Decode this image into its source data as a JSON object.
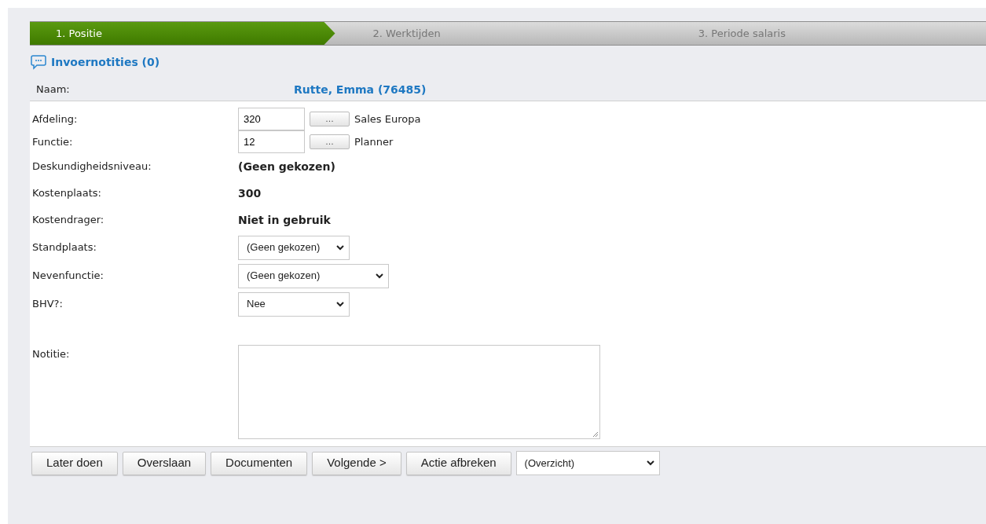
{
  "steps": [
    {
      "label": "1. Positie",
      "selected": true
    },
    {
      "label": "2. Werktijden",
      "selected": false
    },
    {
      "label": "3. Periode salaris",
      "selected": false
    }
  ],
  "notes_link": "Invoernotities (0)",
  "name_row": {
    "label": "Naam:",
    "value": "Rutte, Emma (76485)"
  },
  "fields": [
    {
      "kind": "lookup",
      "label": "Afdeling:",
      "value": "320",
      "button": "...",
      "description": "Sales Europa"
    },
    {
      "kind": "lookup",
      "label": "Functie:",
      "value": "12",
      "button": "...",
      "description": "Planner"
    },
    {
      "kind": "static",
      "label": "Deskundigheidsniveau:",
      "value": "(Geen gekozen)"
    },
    {
      "kind": "static",
      "label": "Kostenplaats:",
      "value": "300"
    },
    {
      "kind": "static",
      "label": "Kostendrager:",
      "value": "Niet in gebruik"
    },
    {
      "kind": "select",
      "label": "Standplaats:",
      "value": "(Geen gekozen)"
    },
    {
      "kind": "wide-select",
      "label": "Nevenfunctie:",
      "value": "(Geen gekozen)"
    },
    {
      "kind": "select",
      "label": "BHV?:",
      "value": "Nee"
    },
    {
      "kind": "textarea",
      "label": "Notitie:"
    }
  ],
  "buttons": [
    "Later doen",
    "Overslaan",
    "Documenten",
    "Volgende >",
    "Actie afbreken"
  ],
  "action_select": "(Overzicht)"
}
